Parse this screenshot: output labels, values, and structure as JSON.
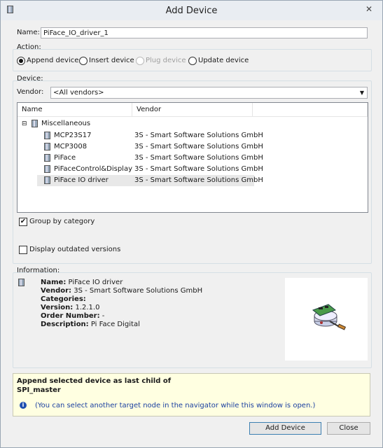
{
  "window": {
    "title": "Add Device",
    "close_icon": "✕"
  },
  "name_field": {
    "label": "Name:",
    "value": "PiFace_IO_driver_1"
  },
  "action": {
    "group_label": "Action:",
    "options": [
      {
        "label": "Append device",
        "checked": true
      },
      {
        "label": "Insert device",
        "checked": false
      },
      {
        "label": "Plug device",
        "disabled": true
      },
      {
        "label": "Update device",
        "checked": false
      }
    ]
  },
  "device": {
    "group_label": "Device:",
    "vendor_label": "Vendor:",
    "vendor_value": "<All vendors>",
    "columns": [
      "Name",
      "Vendor"
    ],
    "category": {
      "expander": "⊟",
      "name": "Miscellaneous"
    },
    "items": [
      {
        "name": "MCP23S17",
        "vendor": "3S - Smart Software Solutions GmbH"
      },
      {
        "name": "MCP3008",
        "vendor": "3S - Smart Software Solutions GmbH"
      },
      {
        "name": "PiFace",
        "vendor": "3S - Smart Software Solutions GmbH"
      },
      {
        "name": "PiFaceControl&Display",
        "vendor": "3S - Smart Software Solutions GmbH"
      },
      {
        "name": "PiFace IO driver",
        "vendor": "3S - Smart Software Solutions GmbH",
        "selected": true
      }
    ],
    "group_by_category": {
      "label": "Group by category",
      "checked": true,
      "mark": "✔"
    },
    "display_outdated": {
      "label": "Display outdated versions",
      "checked": false
    }
  },
  "information": {
    "group_label": "Information:",
    "name": {
      "key": "Name:",
      "value": " PiFace IO driver"
    },
    "vendor": {
      "key": "Vendor:",
      "value": " 3S - Smart Software Solutions GmbH"
    },
    "categories": {
      "key": "Categories:",
      "value": ""
    },
    "version": {
      "key": "Version:",
      "value": " 1.2.1.0"
    },
    "order_number": {
      "key": "Order Number:",
      "value": " -"
    },
    "description": {
      "key": "Description:",
      "value": " Pi Face Digital"
    }
  },
  "message": {
    "line1": "Append selected device as last child of",
    "line2": "SPI_master",
    "info_icon": "i",
    "hint": "(You can select another target node in the navigator while this window is open.)"
  },
  "buttons": {
    "add": "Add Device",
    "close": "Close"
  },
  "colors": {
    "accent": "#3c7fb1",
    "message_bg": "#ffffe1",
    "selection": "#e8e8e8"
  }
}
